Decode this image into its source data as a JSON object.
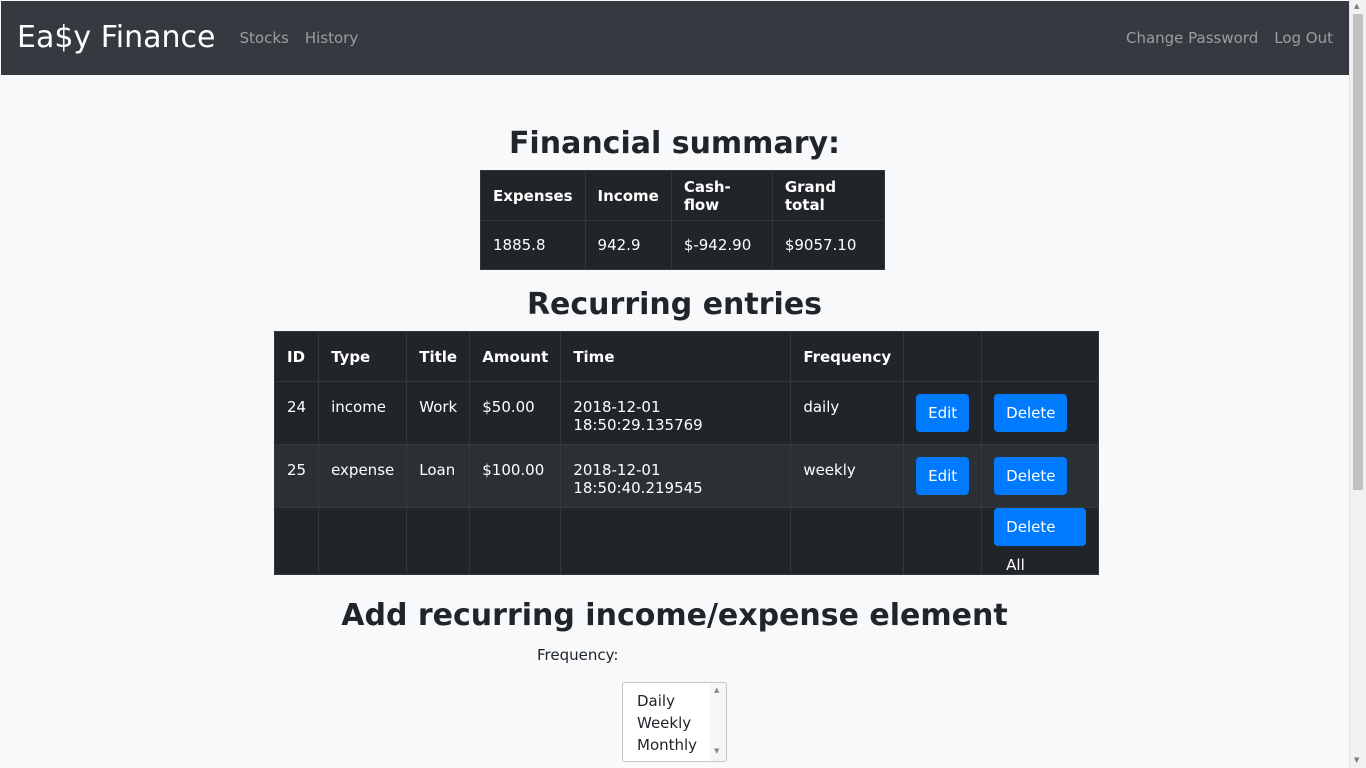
{
  "nav": {
    "brand": "Ea$y Finance",
    "left_links": [
      "Stocks",
      "History"
    ],
    "right_links": [
      "Change Password",
      "Log Out"
    ]
  },
  "summary": {
    "heading": "Financial summary:",
    "columns": [
      "Expenses",
      "Income",
      "Cash-flow",
      "Grand total"
    ],
    "values": [
      "1885.8",
      "942.9",
      "$-942.90",
      "$9057.10"
    ]
  },
  "recurring": {
    "heading": "Recurring entries",
    "columns": [
      "ID",
      "Type",
      "Title",
      "Amount",
      "Time",
      "Frequency"
    ],
    "rows": [
      {
        "id": "24",
        "type": "income",
        "title": "Work",
        "amount": "$50.00",
        "time": "2018-12-01 18:50:29.135769",
        "frequency": "daily"
      },
      {
        "id": "25",
        "type": "expense",
        "title": "Loan",
        "amount": "$100.00",
        "time": "2018-12-01 18:50:40.219545",
        "frequency": "weekly"
      }
    ],
    "edit_label": "Edit",
    "delete_label": "Delete",
    "delete_all_label": "Delete All"
  },
  "add_form": {
    "heading": "Add recurring income/expense element",
    "frequency_label": "Frequency:",
    "frequency_options": [
      "Daily",
      "Weekly",
      "Monthly"
    ]
  },
  "colors": {
    "navbar": "#343a40",
    "table": "#212529",
    "primary": "#007bff",
    "page_bg": "#f8f9fa"
  },
  "icons": {
    "scroll_up": "arrow-up-icon",
    "scroll_down": "arrow-down-icon"
  }
}
